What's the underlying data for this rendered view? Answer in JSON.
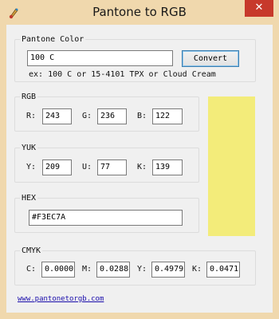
{
  "window": {
    "title": "Pantone to RGB",
    "close_glyph": "✕"
  },
  "pantone": {
    "group_label": "Pantone Color",
    "value": "100 C",
    "convert_label": "Convert",
    "example": "ex: 100 C or 15-4101 TPX or Cloud Cream"
  },
  "rgb": {
    "group_label": "RGB",
    "r_label": "R:",
    "r": "243",
    "g_label": "G:",
    "g": "236",
    "b_label": "B:",
    "b": "122"
  },
  "yuk": {
    "group_label": "YUK",
    "y_label": "Y:",
    "y": "209",
    "u_label": "U:",
    "u": "77",
    "k_label": "K:",
    "k": "139"
  },
  "hex": {
    "group_label": "HEX",
    "value": "#F3EC7A"
  },
  "cmyk": {
    "group_label": "CMYK",
    "c_label": "C:",
    "c": "0.0000",
    "m_label": "M:",
    "m": "0.0288",
    "y_label": "Y:",
    "y": "0.4979",
    "k_label": "K:",
    "k": "0.0471"
  },
  "swatch": {
    "color": "#F3EC7A"
  },
  "footer": {
    "link": "www.pantonetorgb.com"
  },
  "icons": {
    "app": "paint-app-icon",
    "close": "close-icon"
  }
}
